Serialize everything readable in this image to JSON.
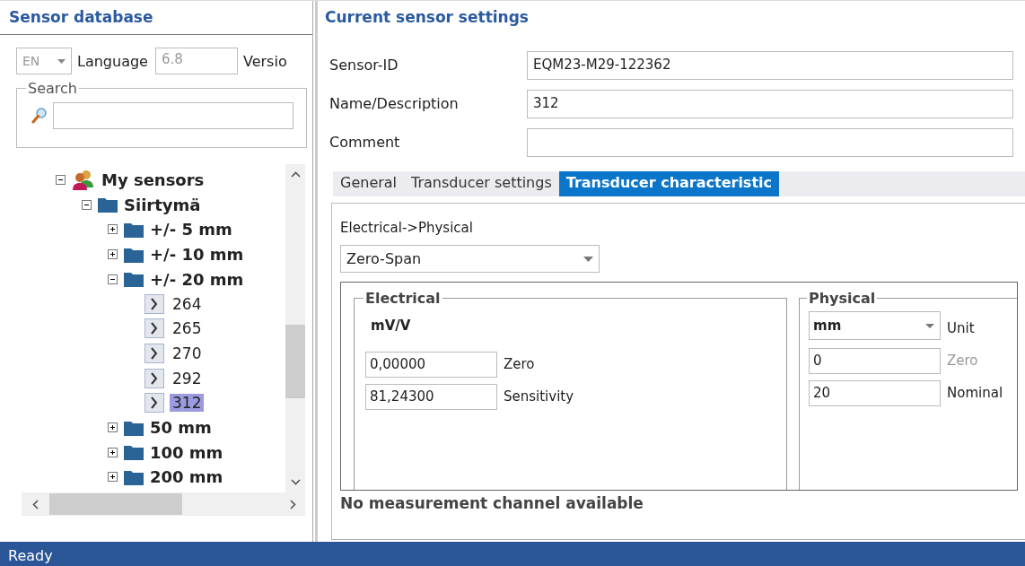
{
  "left_panel": {
    "title": "Sensor database",
    "language": {
      "value": "EN",
      "label": "Language",
      "disabled": true
    },
    "version": {
      "value": "6.8",
      "label": "Versio",
      "disabled": true
    },
    "search": {
      "legend": "Search"
    },
    "tree": [
      {
        "label": "My sensors",
        "kind": "group",
        "expanded": true,
        "children": [
          {
            "label": "Siirtymä",
            "kind": "folder",
            "expanded": true,
            "children": [
              {
                "label": "+/- 5 mm",
                "kind": "folder",
                "expanded": false
              },
              {
                "label": "+/- 10 mm",
                "kind": "folder",
                "expanded": false
              },
              {
                "label": "+/- 20 mm",
                "kind": "folder",
                "expanded": true,
                "children": [
                  {
                    "label": "264",
                    "kind": "sensor",
                    "selected": false
                  },
                  {
                    "label": "265",
                    "kind": "sensor",
                    "selected": false
                  },
                  {
                    "label": "270",
                    "kind": "sensor",
                    "selected": false
                  },
                  {
                    "label": "292",
                    "kind": "sensor",
                    "selected": false
                  },
                  {
                    "label": "312",
                    "kind": "sensor",
                    "selected": true
                  }
                ]
              },
              {
                "label": "50 mm",
                "kind": "folder",
                "expanded": false
              },
              {
                "label": "100 mm",
                "kind": "folder",
                "expanded": false
              },
              {
                "label": "200 mm",
                "kind": "folder",
                "expanded": false
              }
            ]
          }
        ]
      }
    ]
  },
  "right_panel": {
    "title": "Current sensor settings",
    "fields": [
      {
        "label": "Sensor-ID",
        "value": "EQM23-M29-122362"
      },
      {
        "label": "Name/Description",
        "value": "312"
      },
      {
        "label": "Comment"
      }
    ],
    "tabs": [
      {
        "label": "General",
        "selected": false
      },
      {
        "label": "Transducer settings",
        "selected": false
      },
      {
        "label": "Transducer characteristic",
        "selected": true
      }
    ],
    "conversion_label": "Electrical->Physical",
    "conversion": "Zero-Span",
    "electrical": {
      "legend": "Electrical",
      "unit": "mV/V",
      "rows": [
        {
          "value": "0,00000",
          "label": "Zero",
          "disabled": false
        },
        {
          "value": "81,24300",
          "label": "Sensitivity",
          "disabled": false
        }
      ]
    },
    "physical": {
      "legend": "Physical",
      "unit": "mm",
      "unit_label": "Unit",
      "rows": [
        {
          "value": "0",
          "label": "Zero",
          "disabled": true
        },
        {
          "value": "20",
          "label": "Nominal",
          "disabled": false
        }
      ]
    },
    "message": "No measurement channel available"
  },
  "status_bar": "Ready"
}
